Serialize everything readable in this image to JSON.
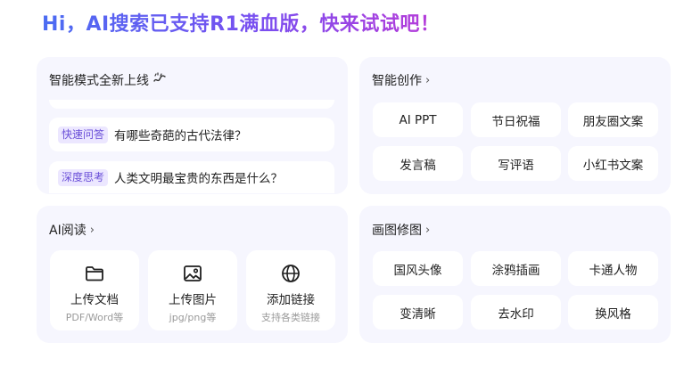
{
  "headline": "Hi，AI搜索已支持R1满血版，快来试试吧！",
  "smart_mode": {
    "title": "智能模式全新上线",
    "title_icon": "sparkle-wave-icon",
    "questions": [
      {
        "tag": "快速问答",
        "text": "有哪些奇葩的古代法律？"
      },
      {
        "tag": "深度思考",
        "text": "人类文明最宝贵的东西是什么？"
      }
    ]
  },
  "smart_create": {
    "title": "智能创作",
    "items": [
      "AI PPT",
      "节日祝福",
      "朋友圈文案",
      "发言稿",
      "写评语",
      "小红书文案"
    ]
  },
  "ai_read": {
    "title": "AI阅读",
    "uploads": [
      {
        "label": "上传文档",
        "sub": "PDF/Word等",
        "icon": "folder-icon"
      },
      {
        "label": "上传图片",
        "sub": "jpg/png等",
        "icon": "image-icon"
      },
      {
        "label": "添加链接",
        "sub": "支持各类链接",
        "icon": "globe-icon"
      }
    ]
  },
  "image_edit": {
    "title": "画图修图",
    "items": [
      "国风头像",
      "涂鸦插画",
      "卡通人物",
      "变清晰",
      "去水印",
      "换风格"
    ]
  },
  "colors": {
    "card_bg": "#f6f6fe",
    "tag_bg": "#ece7ff",
    "tag_text": "#6a4fd8",
    "headline_gradient": [
      "#4b6cf2",
      "#7a4ff0",
      "#b83ad8"
    ]
  }
}
